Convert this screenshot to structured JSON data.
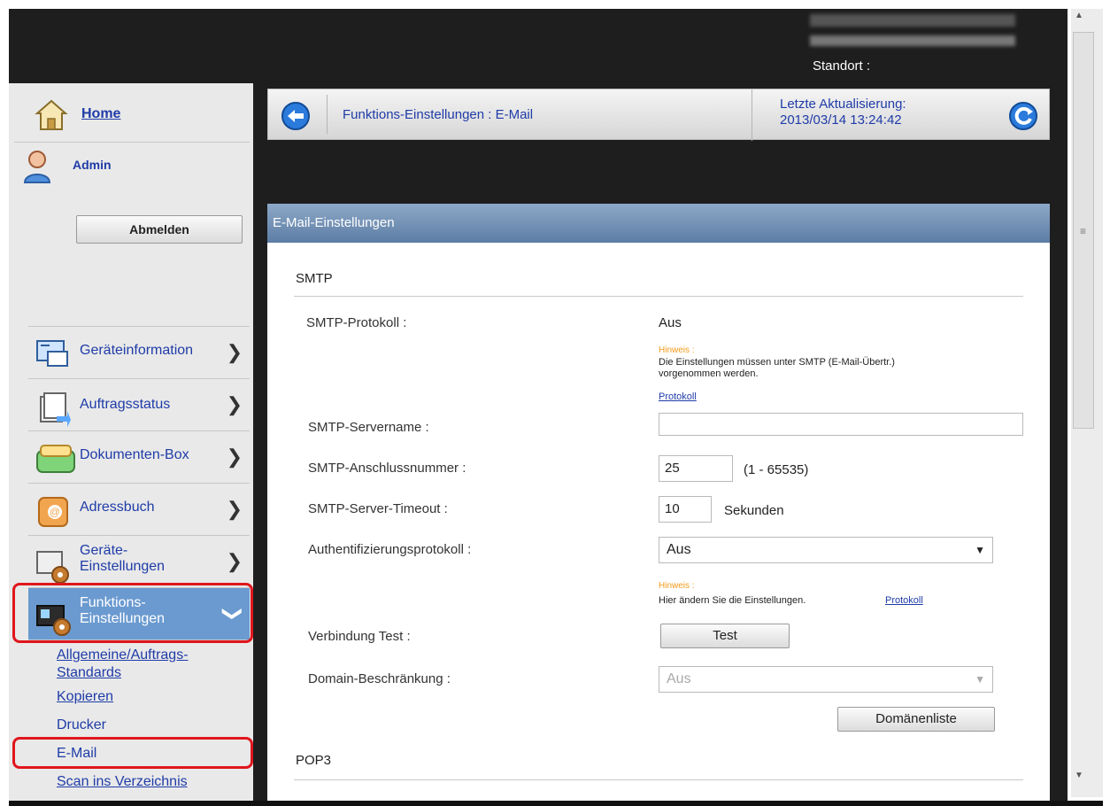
{
  "top": {
    "location_label": "Standort :"
  },
  "sidebar": {
    "home": "Home",
    "admin": "Admin",
    "logout": "Abmelden",
    "items": [
      {
        "label": "Geräteinformation"
      },
      {
        "label": "Auftragsstatus"
      },
      {
        "label": "Dokumenten-Box"
      },
      {
        "label": "Adressbuch"
      },
      {
        "label_line1": "Geräte-",
        "label_line2": "Einstellungen"
      },
      {
        "label_line1": "Funktions-",
        "label_line2": "Einstellungen"
      }
    ],
    "subitems": [
      {
        "line1": "Allgemeine/Auftrags-",
        "line2": "Standards"
      },
      {
        "label": "Kopieren"
      },
      {
        "label": "Drucker"
      },
      {
        "label": "E-Mail"
      },
      {
        "label": "Scan ins Verzeichnis"
      }
    ]
  },
  "header": {
    "breadcrumb": "Funktions-Einstellungen : E-Mail",
    "update_label": "Letzte Aktualisierung:",
    "update_time": "2013/03/14 13:24:42"
  },
  "card": {
    "title": "E-Mail-Einstellungen",
    "smtp_section": "SMTP",
    "pop3_section": "POP3",
    "smtp_protocol_label": "SMTP-Protokoll :",
    "smtp_protocol_value": "Aus",
    "hinweis": "Hinweis :",
    "note1_line1": "Die Einstellungen müssen unter SMTP (E-Mail-Übertr.)",
    "note1_line2": "vorgenommen werden.",
    "protokoll_link": "Protokoll",
    "server_name_label": "SMTP-Servername :",
    "server_name_value": "",
    "port_label": "SMTP-Anschlussnummer :",
    "port_value": "25",
    "port_range": "(1 - 65535)",
    "timeout_label": "SMTP-Server-Timeout :",
    "timeout_value": "10",
    "timeout_unit": "Sekunden",
    "auth_label": "Authentifizierungsprotokoll :",
    "auth_value": "Aus",
    "note2": "Hier ändern Sie die Einstellungen.",
    "connection_test_label": "Verbindung Test :",
    "test_button": "Test",
    "domain_label": "Domain-Beschränkung :",
    "domain_value": "Aus",
    "domain_list_button": "Domänenliste"
  }
}
